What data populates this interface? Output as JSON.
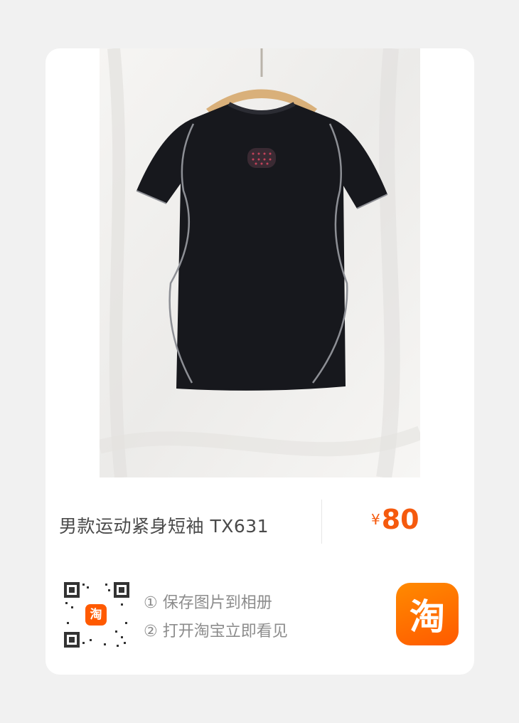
{
  "product": {
    "title": "男款运动紧身短袖 TX631",
    "currency": "¥",
    "price": "80"
  },
  "qr": {
    "center_logo_text": "淘"
  },
  "steps": [
    "① 保存图片到相册",
    "② 打开淘宝立即看见"
  ],
  "app_logo": {
    "text": "淘",
    "color": "#ff6a00"
  },
  "colors": {
    "price": "#f55a0e",
    "card_bg": "#ffffff",
    "page_bg": "#f1f1f1"
  }
}
